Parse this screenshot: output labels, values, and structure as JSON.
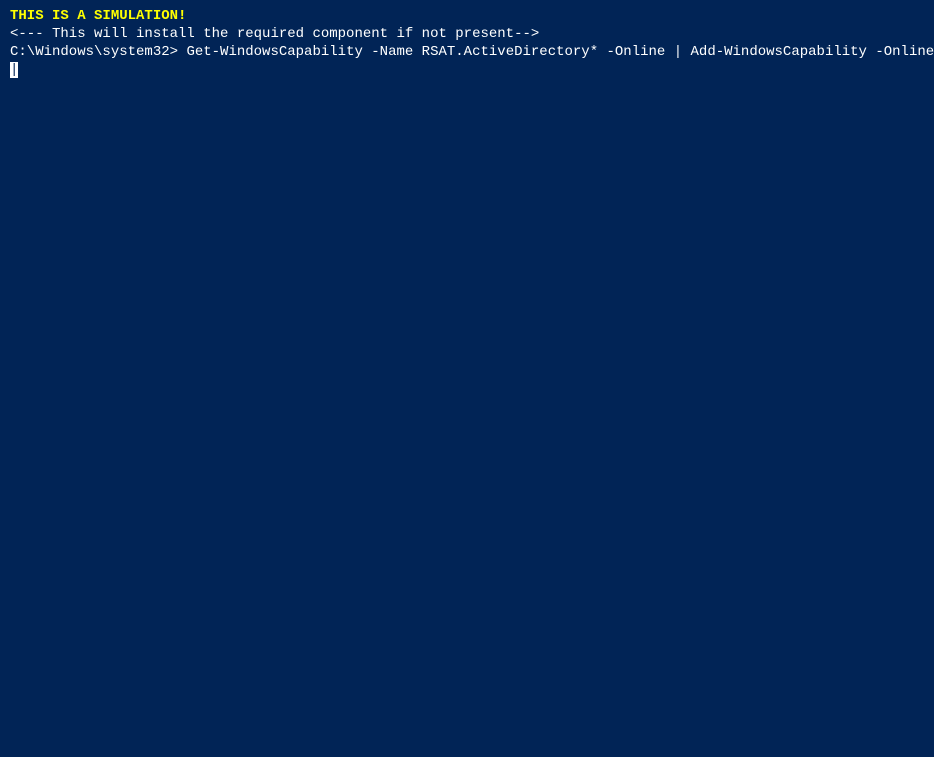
{
  "terminal": {
    "background_color": "#012456",
    "lines": {
      "simulation_warning": "THIS IS A SIMULATION!",
      "comment_line": "<--- This will install the required component if not present-->",
      "prompt": "C:\\Windows\\system32>",
      "command": "Get-WindowsCapability -Name RSAT.ActiveDirectory* -Online | Add-WindowsCapability -Online",
      "cursor_char": "|"
    }
  }
}
